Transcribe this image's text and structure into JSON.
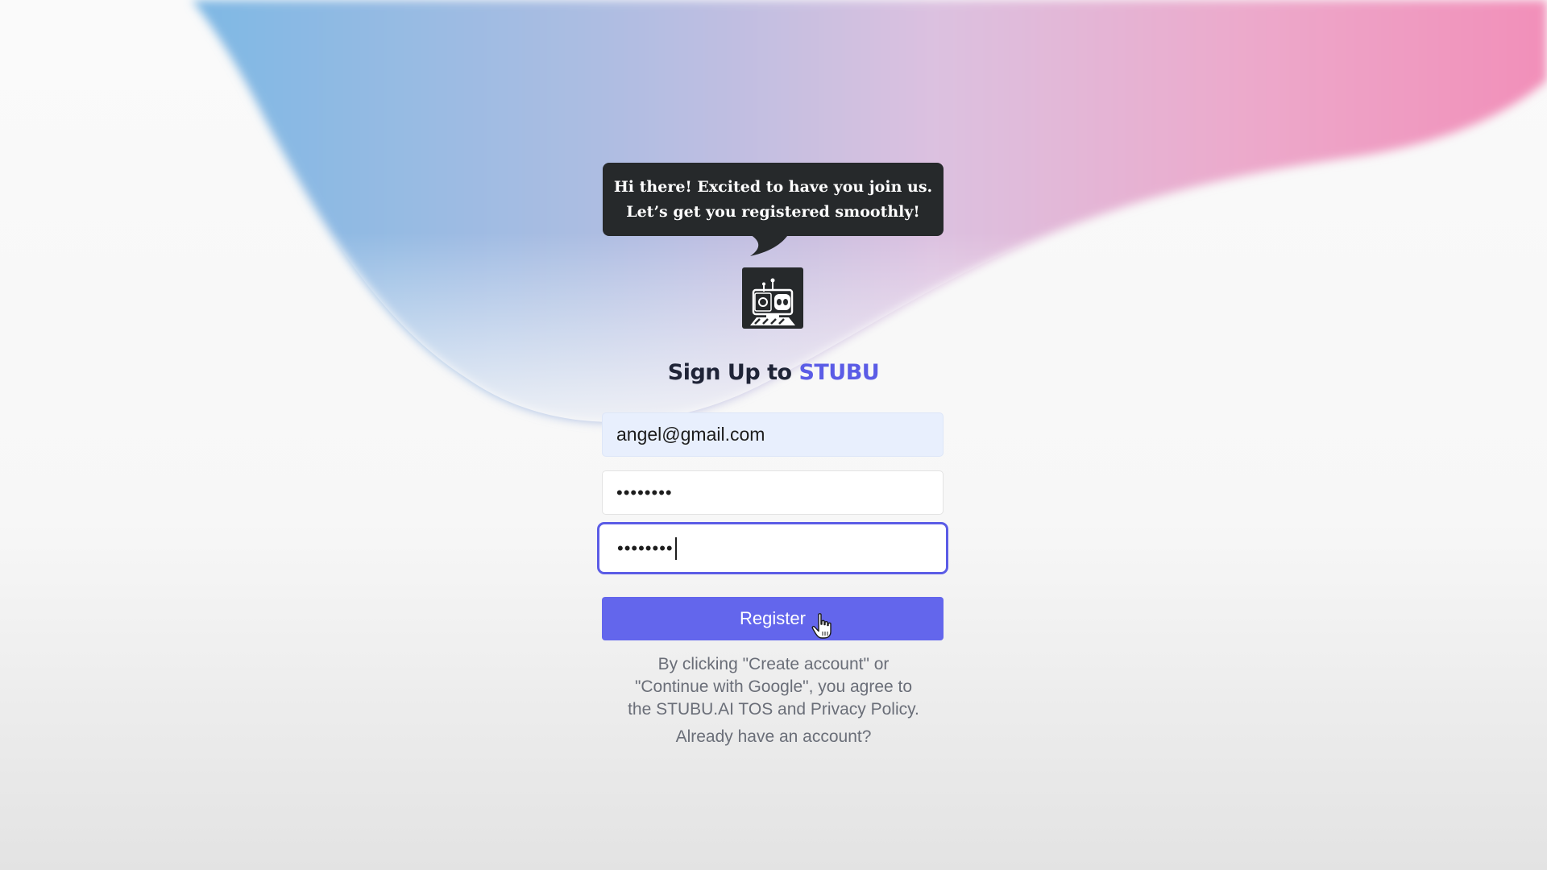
{
  "speech_bubble": {
    "line1": "Hi there! Excited to have you join us.",
    "line2": "Let’s get you registered smoothly!"
  },
  "logo": {
    "icon": "robot-icon"
  },
  "heading": {
    "prefix": "Sign Up to",
    "brand": "STUBU"
  },
  "form": {
    "email_value": "angel@gmail.com",
    "password_value": "••••••••",
    "confirm_password_value": "••••••••",
    "register_label": "Register"
  },
  "legal": {
    "line1": "By clicking \"Create account\" or",
    "line2": "\"Continue with Google\", you agree to",
    "line3": "the STUBU.AI TOS and Privacy Policy."
  },
  "login_link": "Already have an account?",
  "colors": {
    "accent": "#6366ec",
    "brand_text": "#5b5ce6",
    "bubble_bg": "#26292b"
  }
}
